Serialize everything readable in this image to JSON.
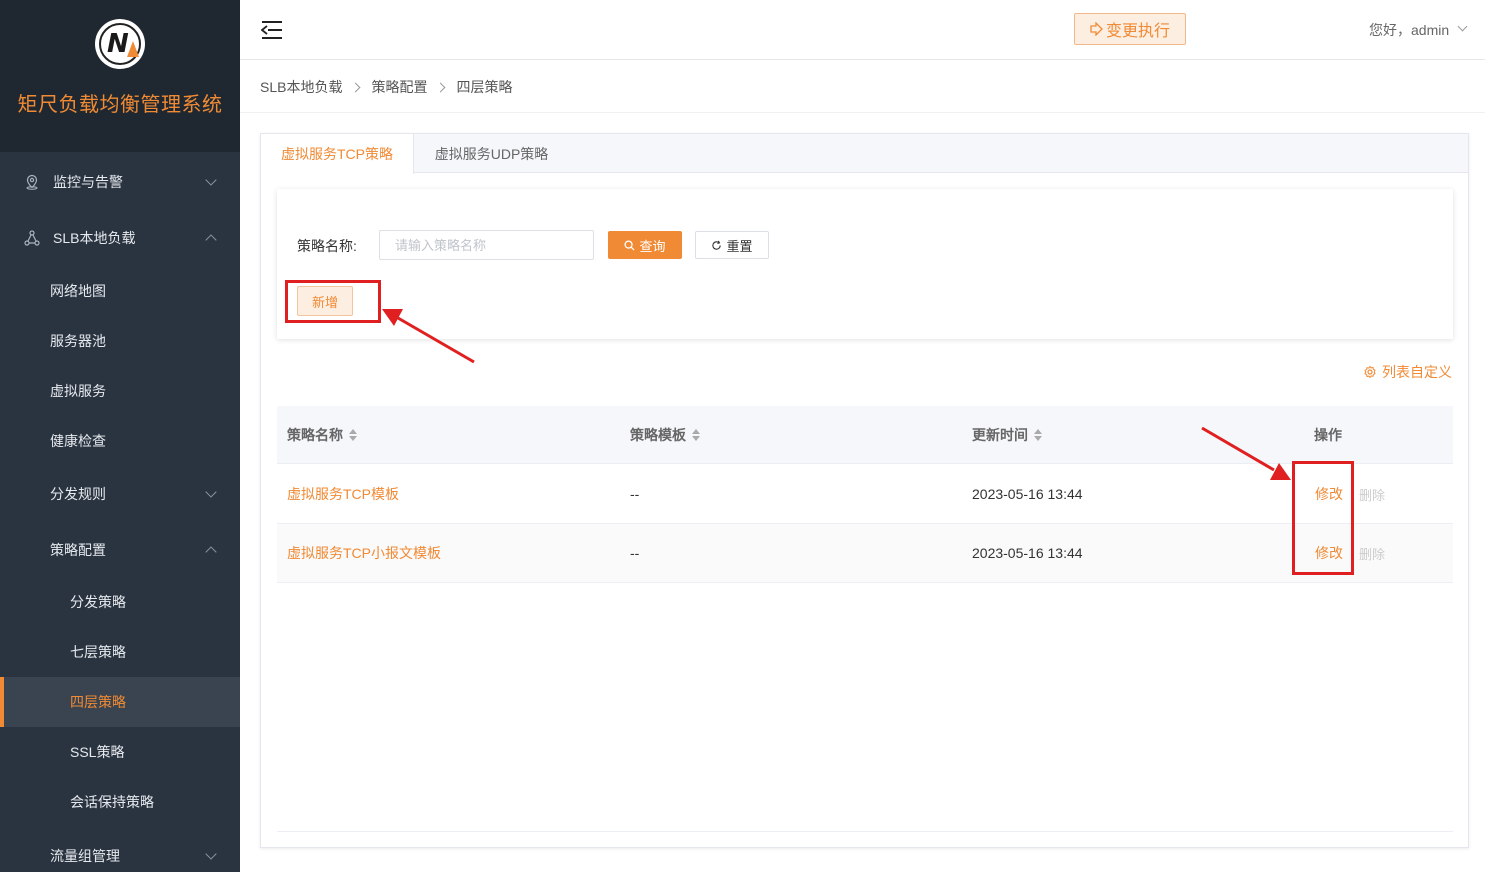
{
  "app": {
    "title": "矩尺负载均衡管理系统"
  },
  "colors": {
    "accent": "#f08a34",
    "sidebar_bg": "#2a3440",
    "annotation": "#e02020"
  },
  "sidebar": {
    "items": [
      {
        "label": "监控与告警",
        "icon": "location-pin-icon",
        "expanded": false,
        "level": 1
      },
      {
        "label": "SLB本地负载",
        "icon": "cluster-icon",
        "expanded": true,
        "level": 1
      },
      {
        "label": "网络地图",
        "level": 2
      },
      {
        "label": "服务器池",
        "level": 2
      },
      {
        "label": "虚拟服务",
        "level": 2
      },
      {
        "label": "健康检查",
        "level": 2
      },
      {
        "label": "分发规则",
        "level": 2,
        "expanded": false
      },
      {
        "label": "策略配置",
        "level": 2,
        "expanded": true
      },
      {
        "label": "分发策略",
        "level": 3
      },
      {
        "label": "七层策略",
        "level": 3
      },
      {
        "label": "四层策略",
        "level": 3,
        "active": true
      },
      {
        "label": "SSL策略",
        "level": 3
      },
      {
        "label": "会话保持策略",
        "level": 3
      },
      {
        "label": "流量组管理",
        "level": 2,
        "expanded": false
      }
    ]
  },
  "header": {
    "exec_button": "变更执行",
    "greeting": "您好，admin"
  },
  "breadcrumb": [
    "SLB本地负载",
    "策略配置",
    "四层策略"
  ],
  "tabs": [
    {
      "label": "虚拟服务TCP策略",
      "active": true
    },
    {
      "label": "虚拟服务UDP策略",
      "active": false
    }
  ],
  "search": {
    "label": "策略名称:",
    "placeholder": "请输入策略名称",
    "query_button": "查询",
    "reset_button": "重置",
    "add_button": "新增"
  },
  "customize_label": "列表自定义",
  "table": {
    "columns": [
      "策略名称",
      "策略模板",
      "更新时间",
      "操作"
    ],
    "rows": [
      {
        "name": "虚拟服务TCP模板",
        "template": "--",
        "updated": "2023-05-16 13:44",
        "edit": "修改",
        "delete": "删除"
      },
      {
        "name": "虚拟服务TCP小报文模板",
        "template": "--",
        "updated": "2023-05-16 13:44",
        "edit": "修改",
        "delete": "删除"
      }
    ]
  }
}
